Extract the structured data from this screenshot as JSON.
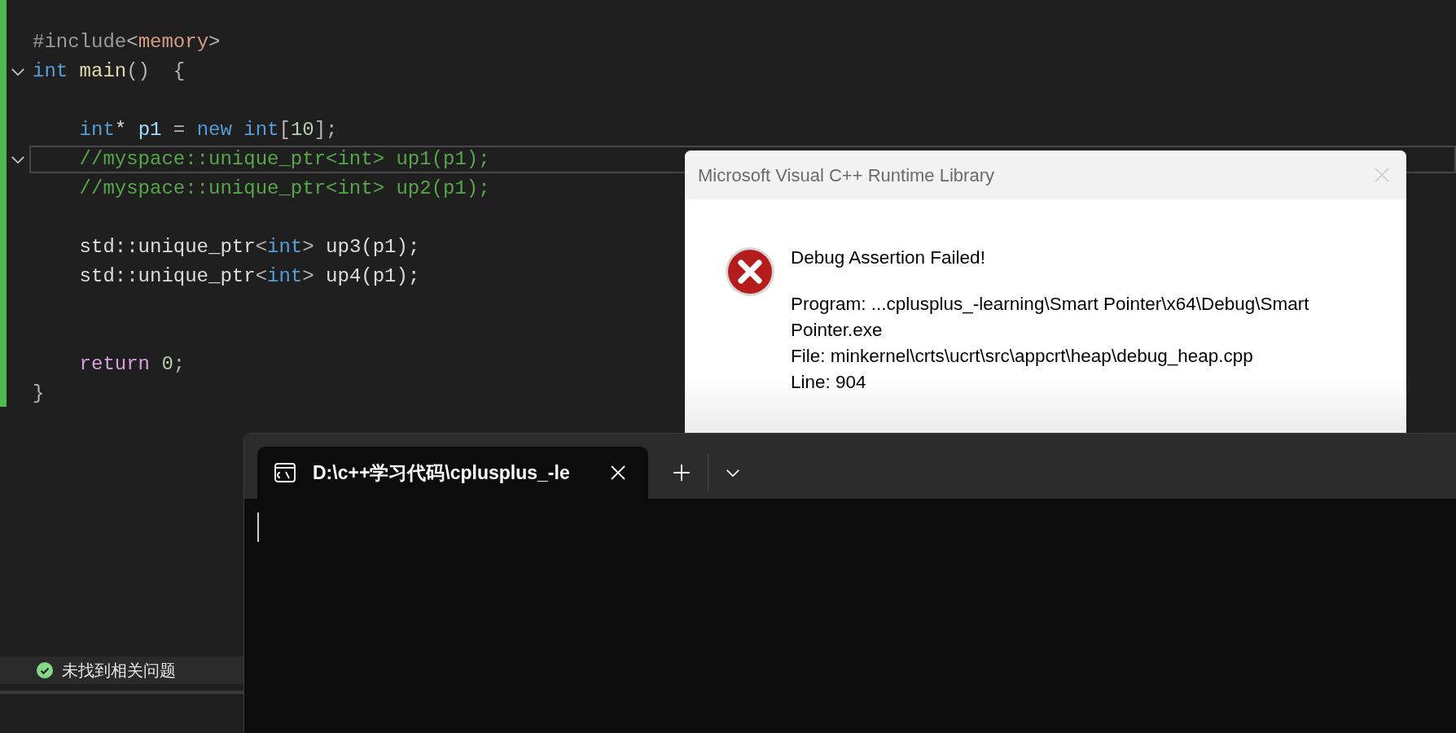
{
  "editor": {
    "lines": [
      {
        "current": false,
        "foldable": false,
        "indented": false,
        "tokens": [
          {
            "kind": "preprocessor",
            "text": "#include"
          },
          {
            "kind": "punct",
            "text": "<"
          },
          {
            "kind": "string",
            "text": "memory"
          },
          {
            "kind": "punct",
            "text": ">"
          }
        ]
      },
      {
        "current": false,
        "foldable": true,
        "indented": false,
        "tokens": [
          {
            "kind": "keyword",
            "text": "int "
          },
          {
            "kind": "function",
            "text": "main"
          },
          {
            "kind": "punct",
            "text": "()  {"
          }
        ]
      },
      {
        "current": false,
        "foldable": false
      },
      {
        "current": false,
        "foldable": false,
        "indented": true,
        "tokens": [
          {
            "kind": "keyword",
            "text": "int"
          },
          {
            "kind": "plain",
            "text": "* "
          },
          {
            "kind": "variable",
            "text": "p1"
          },
          {
            "kind": "punct",
            "text": " = "
          },
          {
            "kind": "keyword",
            "text": "new int"
          },
          {
            "kind": "punct",
            "text": "["
          },
          {
            "kind": "number",
            "text": "10"
          },
          {
            "kind": "punct",
            "text": "];"
          }
        ]
      },
      {
        "current": true,
        "foldable": true,
        "indented": true,
        "tokens": [
          {
            "kind": "comment",
            "text": "//myspace::unique_ptr<int> up1(p1);"
          }
        ]
      },
      {
        "current": false,
        "foldable": false,
        "indented": true,
        "tokens": [
          {
            "kind": "comment",
            "text": "//myspace::unique_ptr<int> up2(p1);"
          }
        ]
      },
      {
        "current": false,
        "foldable": false
      },
      {
        "current": false,
        "foldable": false,
        "indented": true,
        "tokens": [
          {
            "kind": "plain",
            "text": "std::unique_ptr"
          },
          {
            "kind": "punct",
            "text": "<"
          },
          {
            "kind": "keyword",
            "text": "int"
          },
          {
            "kind": "punct",
            "text": ">"
          },
          {
            "kind": "plain",
            "text": " up3(p1);"
          }
        ]
      },
      {
        "current": false,
        "foldable": false,
        "indented": true,
        "tokens": [
          {
            "kind": "plain",
            "text": "std::unique_ptr"
          },
          {
            "kind": "punct",
            "text": "<"
          },
          {
            "kind": "keyword",
            "text": "int"
          },
          {
            "kind": "punct",
            "text": ">"
          },
          {
            "kind": "plain",
            "text": " up4(p1);"
          }
        ]
      },
      {
        "current": false,
        "foldable": false
      },
      {
        "current": false,
        "foldable": false
      },
      {
        "current": false,
        "foldable": false,
        "indented": true,
        "tokens": [
          {
            "kind": "control",
            "text": "return"
          },
          {
            "kind": "number",
            "text": "0"
          },
          {
            "kind": "punct",
            "text": ";"
          }
        ]
      },
      {
        "current": false,
        "foldable": false,
        "indented": false,
        "tokens": [
          {
            "kind": "punct",
            "text": "}"
          }
        ]
      }
    ]
  },
  "status": {
    "text": "未找到相关问题"
  },
  "dialog": {
    "title": "Microsoft Visual C++ Runtime Library",
    "heading": "Debug Assertion Failed!",
    "lines": [
      "Program: ...cplusplus_-learning\\Smart Pointer\\x64\\Debug\\Smart Pointer.exe",
      "File: minkernel\\crts\\ucrt\\src\\appcrt\\heap\\debug_heap.cpp",
      "Line: 904"
    ]
  },
  "terminal": {
    "tabs": [
      {
        "title": "D:\\c++学习代码\\cplusplus_-le",
        "selected": true
      }
    ]
  }
}
